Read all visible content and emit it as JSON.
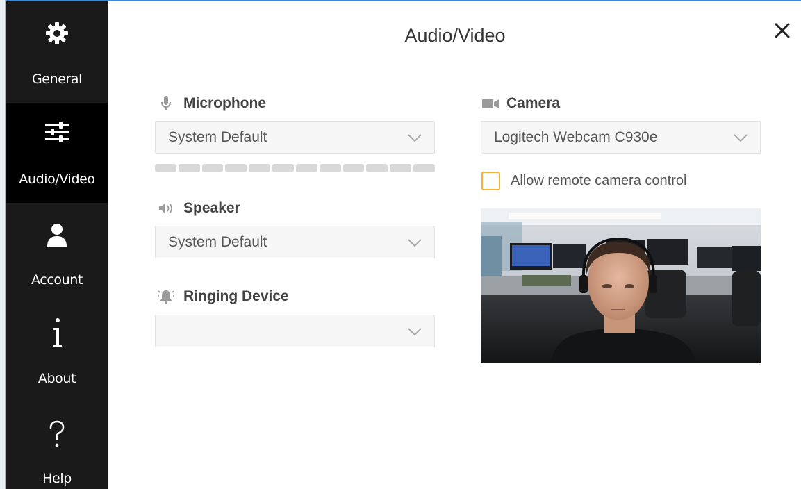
{
  "page": {
    "title": "Audio/Video"
  },
  "colors": {
    "sidebar_bg": "#1a1a1a",
    "sidebar_active_bg": "#000000",
    "checkbox_border": "#f0b43a",
    "title_bar_accent": "#3c86d6"
  },
  "sidebar": {
    "items": [
      {
        "label": "General",
        "icon": "gear-icon",
        "active": false
      },
      {
        "label": "Audio/Video",
        "icon": "sliders-icon",
        "active": true
      },
      {
        "label": "Account",
        "icon": "person-icon",
        "active": false
      },
      {
        "label": "About",
        "icon": "info-icon",
        "active": false
      },
      {
        "label": "Help",
        "icon": "help-icon",
        "active": false
      }
    ]
  },
  "microphone": {
    "label": "Microphone",
    "icon": "microphone-icon",
    "selected": "System Default",
    "level_segments": 12
  },
  "speaker": {
    "label": "Speaker",
    "icon": "speaker-icon",
    "selected": "System Default"
  },
  "ringing": {
    "label": "Ringing Device",
    "icon": "bell-icon",
    "selected": ""
  },
  "camera": {
    "label": "Camera",
    "icon": "video-camera-icon",
    "selected": "Logitech Webcam C930e",
    "remote_control_label": "Allow remote camera control",
    "remote_control_checked": false,
    "preview": "camera-preview-image"
  },
  "close": {
    "icon": "close-icon"
  }
}
